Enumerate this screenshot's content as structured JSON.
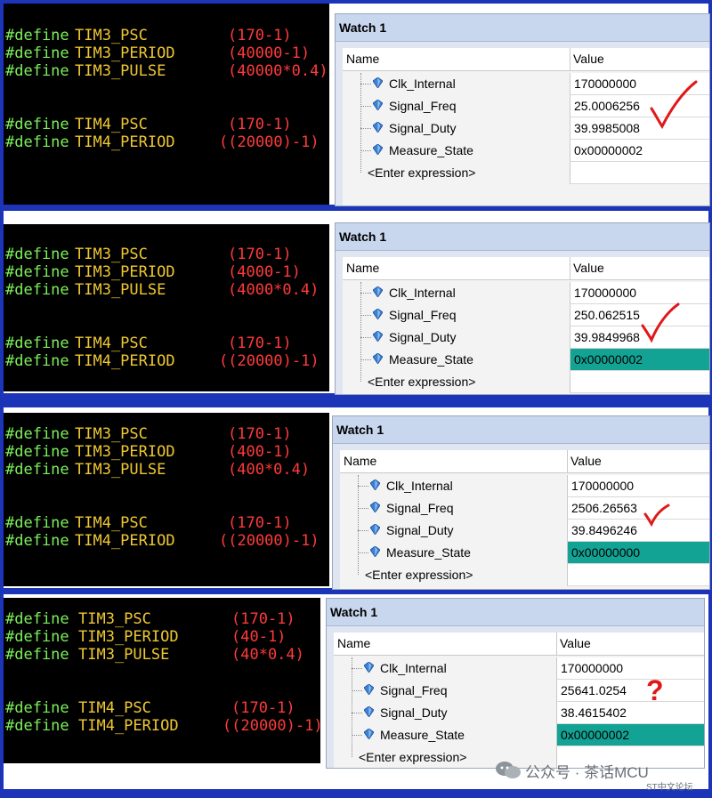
{
  "panels": [
    {
      "defines": [
        {
          "kw": "#define",
          "name": "TIM3_PSC",
          "value": "(170-1)"
        },
        {
          "kw": "#define",
          "name": "TIM3_PERIOD",
          "value": "(40000-1)"
        },
        {
          "kw": "#define",
          "name": "TIM3_PULSE",
          "value": "(40000*0.4)"
        },
        {
          "kw": "#define",
          "name": "TIM4_PSC",
          "value": "(170-1)"
        },
        {
          "kw": "#define",
          "name": "TIM4_PERIOD",
          "value": "((20000)-1)"
        }
      ],
      "watch": {
        "title": "Watch 1",
        "col_name": "Name",
        "col_value": "Value",
        "rows": [
          {
            "name": "Clk_Internal",
            "value": "170000000",
            "highlight": false
          },
          {
            "name": "Signal_Freq",
            "value": "25.0006256",
            "highlight": false
          },
          {
            "name": "Signal_Duty",
            "value": "39.9985008",
            "highlight": false
          },
          {
            "name": "Measure_State",
            "value": "0x00000002",
            "highlight": false
          }
        ],
        "enter": "<Enter expression>"
      },
      "mark": "check"
    },
    {
      "defines": [
        {
          "kw": "#define",
          "name": "TIM3_PSC",
          "value": "(170-1)"
        },
        {
          "kw": "#define",
          "name": "TIM3_PERIOD",
          "value": "(4000-1)"
        },
        {
          "kw": "#define",
          "name": "TIM3_PULSE",
          "value": "(4000*0.4)"
        },
        {
          "kw": "#define",
          "name": "TIM4_PSC",
          "value": "(170-1)"
        },
        {
          "kw": "#define",
          "name": "TIM4_PERIOD",
          "value": "((20000)-1)"
        }
      ],
      "watch": {
        "title": "Watch 1",
        "col_name": "Name",
        "col_value": "Value",
        "rows": [
          {
            "name": "Clk_Internal",
            "value": "170000000",
            "highlight": false
          },
          {
            "name": "Signal_Freq",
            "value": "250.062515",
            "highlight": false
          },
          {
            "name": "Signal_Duty",
            "value": "39.9849968",
            "highlight": false
          },
          {
            "name": "Measure_State",
            "value": "0x00000002",
            "highlight": true
          }
        ],
        "enter": "<Enter expression>"
      },
      "mark": "check"
    },
    {
      "defines": [
        {
          "kw": "#define",
          "name": "TIM3_PSC",
          "value": "(170-1)"
        },
        {
          "kw": "#define",
          "name": "TIM3_PERIOD",
          "value": "(400-1)"
        },
        {
          "kw": "#define",
          "name": "TIM3_PULSE",
          "value": "(400*0.4)"
        },
        {
          "kw": "#define",
          "name": "TIM4_PSC",
          "value": "(170-1)"
        },
        {
          "kw": "#define",
          "name": "TIM4_PERIOD",
          "value": "((20000)-1)"
        }
      ],
      "watch": {
        "title": "Watch 1",
        "col_name": "Name",
        "col_value": "Value",
        "rows": [
          {
            "name": "Clk_Internal",
            "value": "170000000",
            "highlight": false
          },
          {
            "name": "Signal_Freq",
            "value": "2506.26563",
            "highlight": false
          },
          {
            "name": "Signal_Duty",
            "value": "39.8496246",
            "highlight": false
          },
          {
            "name": "Measure_State",
            "value": "0x00000000",
            "highlight": true
          }
        ],
        "enter": "<Enter expression>"
      },
      "mark": "check"
    },
    {
      "defines": [
        {
          "kw": "#define",
          "name": "TIM3_PSC",
          "value": "(170-1)"
        },
        {
          "kw": "#define",
          "name": "TIM3_PERIOD",
          "value": "(40-1)"
        },
        {
          "kw": "#define",
          "name": "TIM3_PULSE",
          "value": "(40*0.4)"
        },
        {
          "kw": "#define",
          "name": "TIM4_PSC",
          "value": "(170-1)"
        },
        {
          "kw": "#define",
          "name": "TIM4_PERIOD",
          "value": "((20000)-1)"
        }
      ],
      "watch": {
        "title": "Watch 1",
        "col_name": "Name",
        "col_value": "Value",
        "rows": [
          {
            "name": "Clk_Internal",
            "value": "170000000",
            "highlight": false
          },
          {
            "name": "Signal_Freq",
            "value": "25641.0254",
            "highlight": false
          },
          {
            "name": "Signal_Duty",
            "value": "38.4615402",
            "highlight": false
          },
          {
            "name": "Measure_State",
            "value": "0x00000002",
            "highlight": true
          }
        ],
        "enter": "<Enter expression>"
      },
      "mark": "question",
      "mark_text": "?"
    }
  ],
  "colors": {
    "background": "#1c34b8",
    "define_keyword": "#7cf05a",
    "macro_name": "#f0c832",
    "macro_value": "#ff3a3a",
    "highlight": "#12a394",
    "annotation": "#e01818"
  },
  "watermark": {
    "icon": "wechat-icon",
    "text": "公众号 · 茶话MCU",
    "sub": "ST中文论坛"
  }
}
